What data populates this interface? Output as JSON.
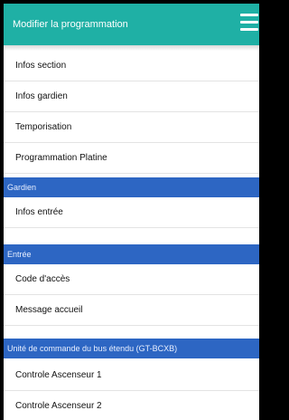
{
  "header": {
    "title": "Modifier la programmation",
    "menu_icon": "hamburger-menu-icon"
  },
  "colors": {
    "header_bg": "#1fb0a5",
    "section_bg": "#2d66c3",
    "row_bg": "#ffffff",
    "divider": "#e3e3e3"
  },
  "list": {
    "items": [
      {
        "type": "item",
        "label": "Infos section"
      },
      {
        "type": "item",
        "label": "Infos gardien"
      },
      {
        "type": "item",
        "label": "Temporisation"
      },
      {
        "type": "item",
        "label": "Programmation Platine"
      },
      {
        "type": "section",
        "label": "Gardien"
      },
      {
        "type": "item",
        "label": "Infos entrée"
      },
      {
        "type": "section",
        "label": "Entrée"
      },
      {
        "type": "item",
        "label": "Code d'accès"
      },
      {
        "type": "item",
        "label": "Message accueil"
      },
      {
        "type": "section",
        "label": "Unité de commande du bus étendu (GT-BCXB)"
      },
      {
        "type": "item",
        "label": "Controle Ascenseur 1"
      },
      {
        "type": "item",
        "label": "Controle Ascenseur 2"
      }
    ]
  }
}
